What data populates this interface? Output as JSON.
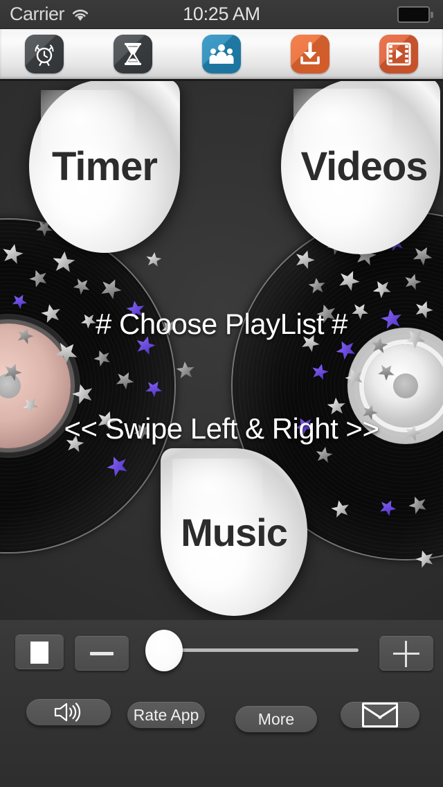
{
  "status_bar": {
    "carrier": "Carrier",
    "time": "10:25 AM",
    "wifi_icon": "wifi-icon",
    "battery_icon": "battery-icon"
  },
  "toolbar": {
    "items": [
      {
        "name": "alarm-clock",
        "icon": "alarm-clock-icon",
        "color": "#3f4245"
      },
      {
        "name": "hourglass",
        "icon": "hourglass-icon",
        "color": "#3f4245"
      },
      {
        "name": "group",
        "icon": "people-group-icon",
        "color": "#2287bb"
      },
      {
        "name": "download",
        "icon": "download-icon",
        "color": "#ec6b31"
      },
      {
        "name": "videos",
        "icon": "video-film-icon",
        "color": "#dd5c2f"
      }
    ]
  },
  "stage": {
    "timer_label": "Timer",
    "videos_label": "Videos",
    "music_label": "Music",
    "playlist_text": "# Choose PlayList #",
    "swipe_text": "<< Swipe Left & Right >>"
  },
  "controls": {
    "stop_icon": "stop-square-icon",
    "minus_icon": "minus-icon",
    "plus_icon": "plus-icon",
    "slider_value": 0,
    "slider_min": 0,
    "slider_max": 100
  },
  "footer": {
    "volume_icon": "speaker-volume-icon",
    "rate_label": "Rate App",
    "more_label": "More",
    "mail_icon": "envelope-icon"
  },
  "colors": {
    "background": "#2e2e2e",
    "toolbar_bg": "#f0f0f0",
    "accent_blue": "#2287bb",
    "accent_orange": "#ec6b31",
    "text_white": "#ffffff",
    "star_purple": "#6b4fd8",
    "star_silver": "#d8d8d8"
  }
}
